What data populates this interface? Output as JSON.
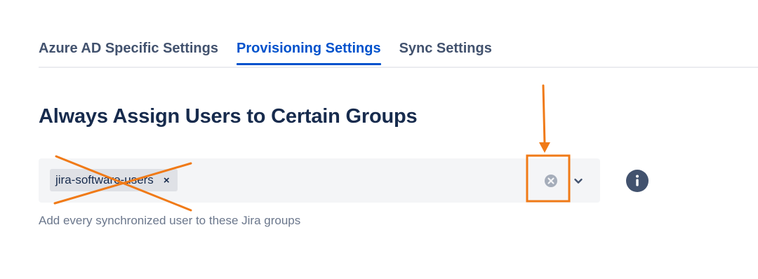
{
  "tabs": [
    {
      "label": "Azure AD Specific Settings",
      "active": false
    },
    {
      "label": "Provisioning Settings",
      "active": true
    },
    {
      "label": "Sync Settings",
      "active": false
    }
  ],
  "section": {
    "title": "Always Assign Users to Certain Groups"
  },
  "group_select": {
    "tags": [
      {
        "label": "jira-software-users",
        "remove_icon": "×"
      }
    ],
    "clear_icon": "clear-circle-icon",
    "dropdown_icon": "chevron-down-icon",
    "helper_text": "Add every synchronized user to these Jira groups"
  },
  "info": {
    "icon": "info-icon"
  },
  "colors": {
    "accent": "#0052cc",
    "annotation": "#f07a17",
    "text_primary": "#172b4d",
    "text_secondary": "#42526e",
    "field_bg": "#f4f5f7"
  }
}
